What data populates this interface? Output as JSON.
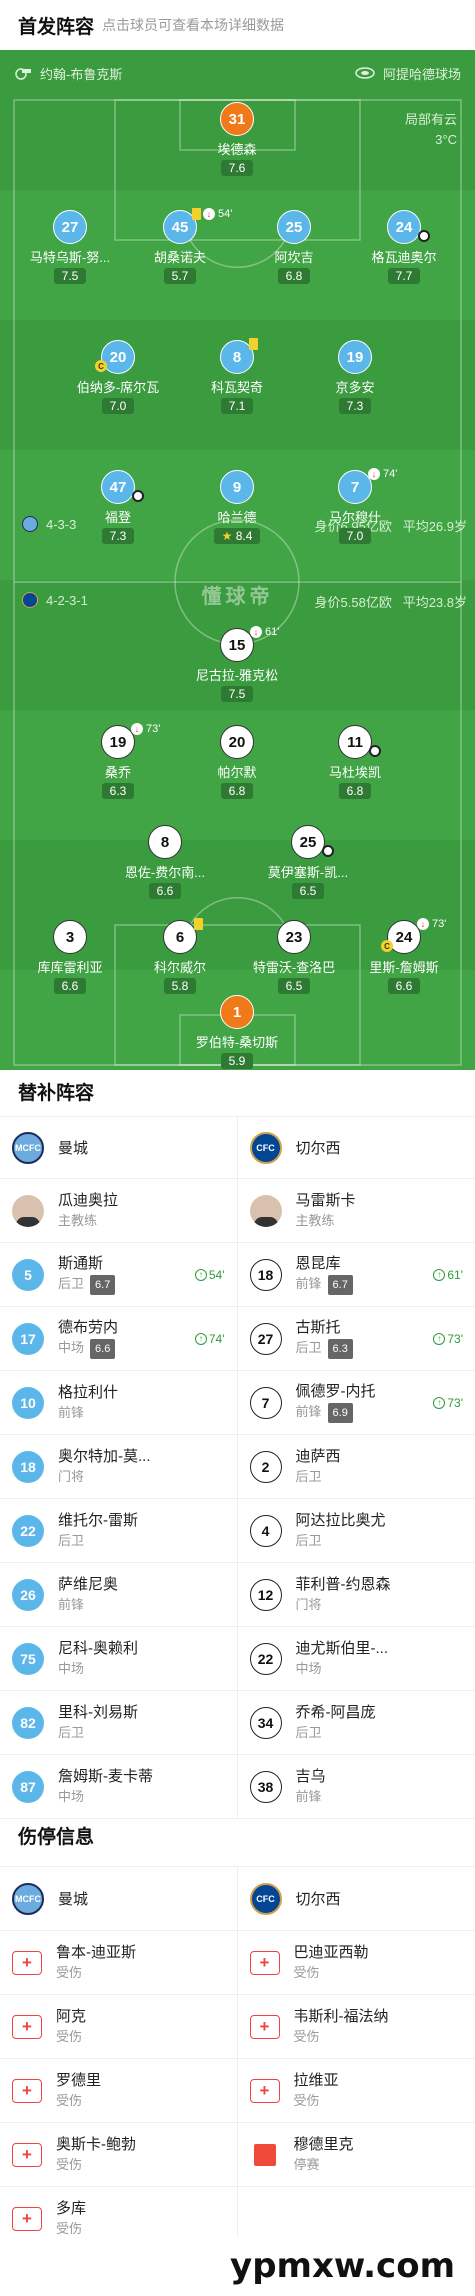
{
  "header": {
    "title": "首发阵容",
    "subtitle": "点击球员可查看本场详细数据"
  },
  "pitch": {
    "referee": "约翰-布鲁克斯",
    "stadium": "阿提哈德球场",
    "weather": "局部有云",
    "temperature": "3°C",
    "center_watermark": "懂球帝",
    "home": {
      "formation": "4-3-3",
      "value": "身价6.95亿欧",
      "age": "平均26.9岁"
    },
    "away": {
      "formation": "4-2-3-1",
      "value": "身价5.58亿欧",
      "age": "平均23.8岁"
    },
    "players": [
      {
        "num": "31",
        "name": "埃德森",
        "rating": "7.6"
      },
      {
        "num": "27",
        "name": "马特乌斯-努...",
        "rating": "7.5"
      },
      {
        "num": "45",
        "name": "胡桑诺夫",
        "rating": "5.7",
        "min": "54'"
      },
      {
        "num": "25",
        "name": "阿坎吉",
        "rating": "6.8"
      },
      {
        "num": "24",
        "name": "格瓦迪奥尔",
        "rating": "7.7"
      },
      {
        "num": "20",
        "name": "伯纳多-席尔瓦",
        "rating": "7.0"
      },
      {
        "num": "8",
        "name": "科瓦契奇",
        "rating": "7.1"
      },
      {
        "num": "19",
        "name": "京多安",
        "rating": "7.3"
      },
      {
        "num": "47",
        "name": "福登",
        "rating": "7.3"
      },
      {
        "num": "9",
        "name": "哈兰德",
        "rating": "8.4"
      },
      {
        "num": "7",
        "name": "马尔穆什",
        "rating": "7.0",
        "min": "74'"
      },
      {
        "num": "15",
        "name": "尼古拉-雅克松",
        "rating": "7.5",
        "min": "61'"
      },
      {
        "num": "19",
        "name": "桑乔",
        "rating": "6.3",
        "min": "73'"
      },
      {
        "num": "20",
        "name": "帕尔默",
        "rating": "6.8"
      },
      {
        "num": "11",
        "name": "马杜埃凯",
        "rating": "6.8"
      },
      {
        "num": "8",
        "name": "恩佐-费尔南...",
        "rating": "6.6"
      },
      {
        "num": "25",
        "name": "莫伊塞斯-凯...",
        "rating": "6.5"
      },
      {
        "num": "3",
        "name": "库库雷利亚",
        "rating": "6.6"
      },
      {
        "num": "6",
        "name": "科尔威尔",
        "rating": "5.8"
      },
      {
        "num": "23",
        "name": "特雷沃-查洛巴",
        "rating": "6.5"
      },
      {
        "num": "24",
        "name": "里斯-詹姆斯",
        "rating": "6.6",
        "min": "73'"
      },
      {
        "num": "1",
        "name": "罗伯特-桑切斯",
        "rating": "5.9"
      }
    ]
  },
  "subs": {
    "title": "替补阵容",
    "home_team": "曼城",
    "away_team": "切尔西",
    "home_crest": "MCFC",
    "away_crest": "CFC",
    "home_coach": {
      "name": "瓜迪奥拉",
      "role": "主教练"
    },
    "away_coach": {
      "name": "马雷斯卡",
      "role": "主教练"
    },
    "home": [
      {
        "num": "5",
        "name": "斯通斯",
        "pos": "后卫",
        "rating": "6.7",
        "min": "54'"
      },
      {
        "num": "17",
        "name": "德布劳内",
        "pos": "中场",
        "rating": "6.6",
        "min": "74'"
      },
      {
        "num": "10",
        "name": "格拉利什",
        "pos": "前锋"
      },
      {
        "num": "18",
        "name": "奥尔特加-莫...",
        "pos": "门将"
      },
      {
        "num": "22",
        "name": "维托尔-雷斯",
        "pos": "后卫"
      },
      {
        "num": "26",
        "name": "萨维尼奥",
        "pos": "前锋"
      },
      {
        "num": "75",
        "name": "尼科-奥赖利",
        "pos": "中场"
      },
      {
        "num": "82",
        "name": "里科-刘易斯",
        "pos": "后卫"
      },
      {
        "num": "87",
        "name": "詹姆斯-麦卡蒂",
        "pos": "中场"
      }
    ],
    "away": [
      {
        "num": "18",
        "name": "恩昆库",
        "pos": "前锋",
        "rating": "6.7",
        "min": "61'"
      },
      {
        "num": "27",
        "name": "古斯托",
        "pos": "后卫",
        "rating": "6.3",
        "min": "73'"
      },
      {
        "num": "7",
        "name": "佩德罗-内托",
        "pos": "前锋",
        "rating": "6.9",
        "min": "73'"
      },
      {
        "num": "2",
        "name": "迪萨西",
        "pos": "后卫"
      },
      {
        "num": "4",
        "name": "阿达拉比奥尤",
        "pos": "后卫"
      },
      {
        "num": "12",
        "name": "菲利普-约恩森",
        "pos": "门将"
      },
      {
        "num": "22",
        "name": "迪尤斯伯里-...",
        "pos": "中场"
      },
      {
        "num": "34",
        "name": "乔希-阿昌庞",
        "pos": "后卫"
      },
      {
        "num": "38",
        "name": "吉乌",
        "pos": "前锋"
      }
    ]
  },
  "injuries": {
    "title": "伤停信息",
    "home": [
      {
        "name": "鲁本-迪亚斯",
        "status": "受伤"
      },
      {
        "name": "阿克",
        "status": "受伤"
      },
      {
        "name": "罗德里",
        "status": "受伤"
      },
      {
        "name": "奥斯卡-鲍勃",
        "status": "受伤"
      },
      {
        "name": "多库",
        "status": "受伤"
      }
    ],
    "away": [
      {
        "name": "巴迪亚西勒",
        "status": "受伤",
        "icon": "medkit"
      },
      {
        "name": "韦斯利-福法纳",
        "status": "受伤",
        "icon": "medkit"
      },
      {
        "name": "拉维亚",
        "status": "受伤",
        "icon": "medkit"
      },
      {
        "name": "穆德里克",
        "status": "停赛",
        "icon": "red-card"
      }
    ]
  },
  "footer": {
    "watermark": "ypmxw.com"
  },
  "colors": {
    "pitch": "#3b9b3f",
    "city": "#5bb7ea",
    "chelsea": "#ffffff",
    "keeper": "#f07a1a"
  }
}
